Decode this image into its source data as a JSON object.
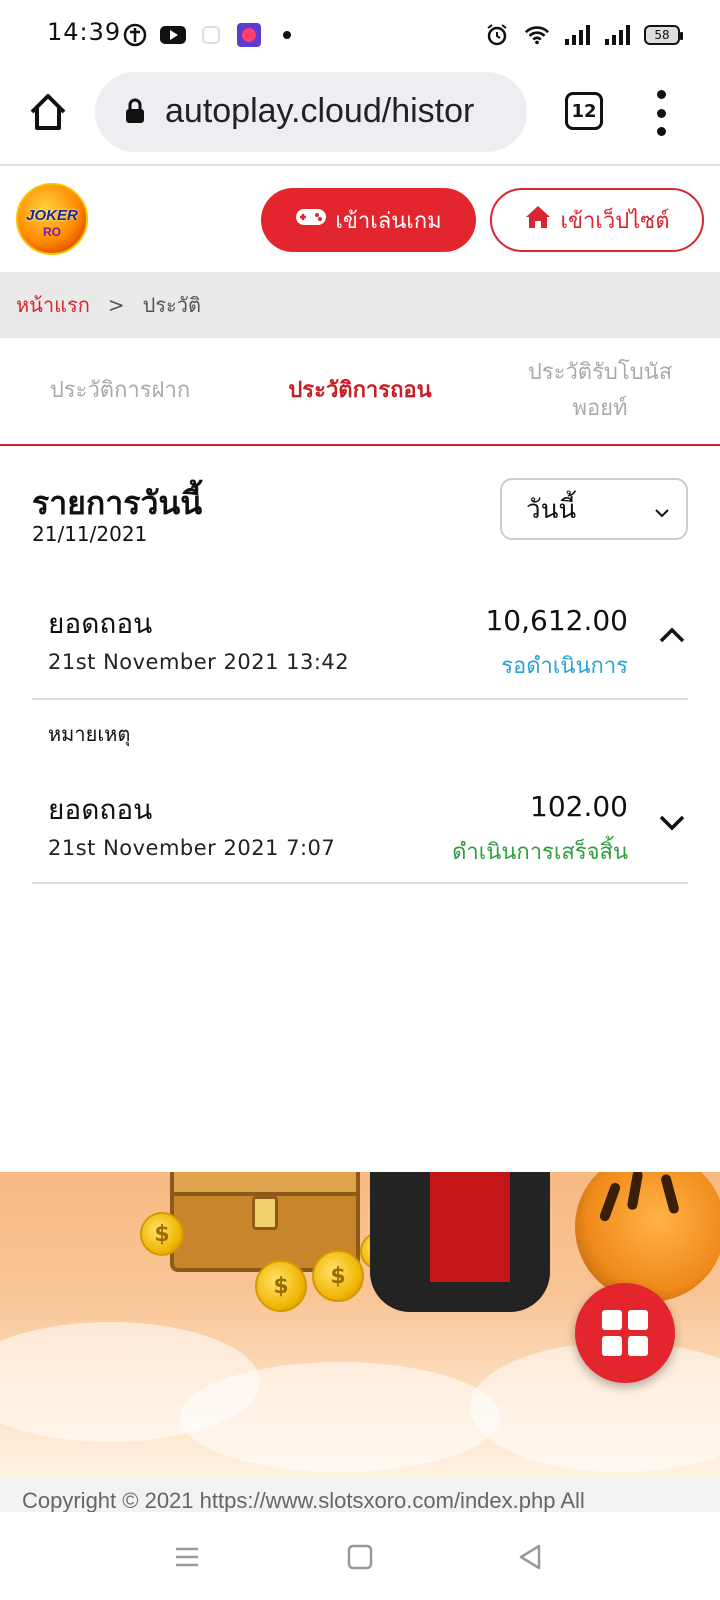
{
  "status_bar": {
    "time": "14:39",
    "battery": "58",
    "icons": [
      "notification-icon",
      "youtube-icon",
      "app-icon",
      "dot-icon",
      "alarm-icon",
      "wifi-icon",
      "signal-icon",
      "signal-icon-2",
      "battery-icon"
    ]
  },
  "browser": {
    "url": "autoplay.cloud/histor",
    "tab_count": "12"
  },
  "header": {
    "logo_text": "JOKER",
    "logo_sub": "RO",
    "play_button": "เข้าเล่นเกม",
    "site_button": "เข้าเว็ปไซต์"
  },
  "breadcrumb": {
    "home": "หน้าแรก",
    "separator": ">",
    "current": "ประวัติ"
  },
  "tabs": {
    "deposit": "ประวัติการฝาก",
    "withdraw": "ประวัติการถอน",
    "bonus_line1": "ประวัติรับโบนัส",
    "bonus_line2": "พอยท์"
  },
  "today": {
    "title": "รายการวันนี้",
    "date": "21/11/2021",
    "filter_value": "วันนี้"
  },
  "transactions": [
    {
      "label": "ยอดถอน",
      "datetime": "21st November 2021 13:42",
      "amount": "10,612.00",
      "status": "รอดำเนินการ",
      "note_label": "หมายเหตุ"
    },
    {
      "label": "ยอดถอน",
      "datetime": "21st November 2021 7:07",
      "amount": "102.00",
      "status": "ดำเนินการเสร็จสิ้น"
    }
  ],
  "footer": {
    "text": "Copyright © 2021 https://www.slotsxoro.com/index.php All"
  },
  "colors": {
    "accent": "#e3252d",
    "pending": "#2aa2d6",
    "done": "#2e9e3e"
  }
}
